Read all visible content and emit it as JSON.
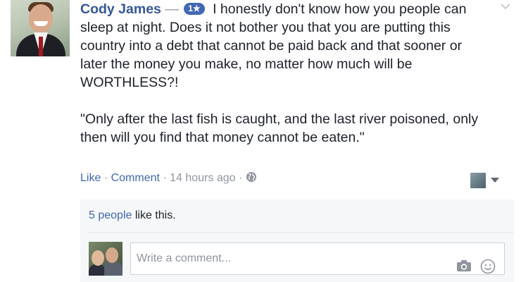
{
  "comment": {
    "author": "Cody James",
    "dash": "—",
    "badge": "1★",
    "paragraph1": "I honestly don't know how you people can sleep at night. Does it not bother you that you are putting this country into a debt that cannot be paid back and that sooner or later the money you make, no matter how much will be WORTHLESS?!",
    "paragraph2": "\"Only after the last fish is caught, and the last river poisoned, only then will you find that money cannot be eaten.\""
  },
  "actions": {
    "like": "Like",
    "sep1": " · ",
    "comment": "Comment",
    "sep2": " · ",
    "timestamp": "14 hours ago",
    "sep3": " · "
  },
  "likes": {
    "count_text": "5 people",
    "suffix": " like this."
  },
  "composer": {
    "placeholder": "Write a comment..."
  },
  "icons": {
    "globe": "globe-icon",
    "chevron": "chevron-down-icon",
    "camera": "camera-icon",
    "smiley": "smiley-icon"
  },
  "colors": {
    "link": "#4267b2",
    "author": "#365899",
    "muted": "#90949c",
    "badge": "#4267b2",
    "likes_background": "#f6f7f9"
  }
}
